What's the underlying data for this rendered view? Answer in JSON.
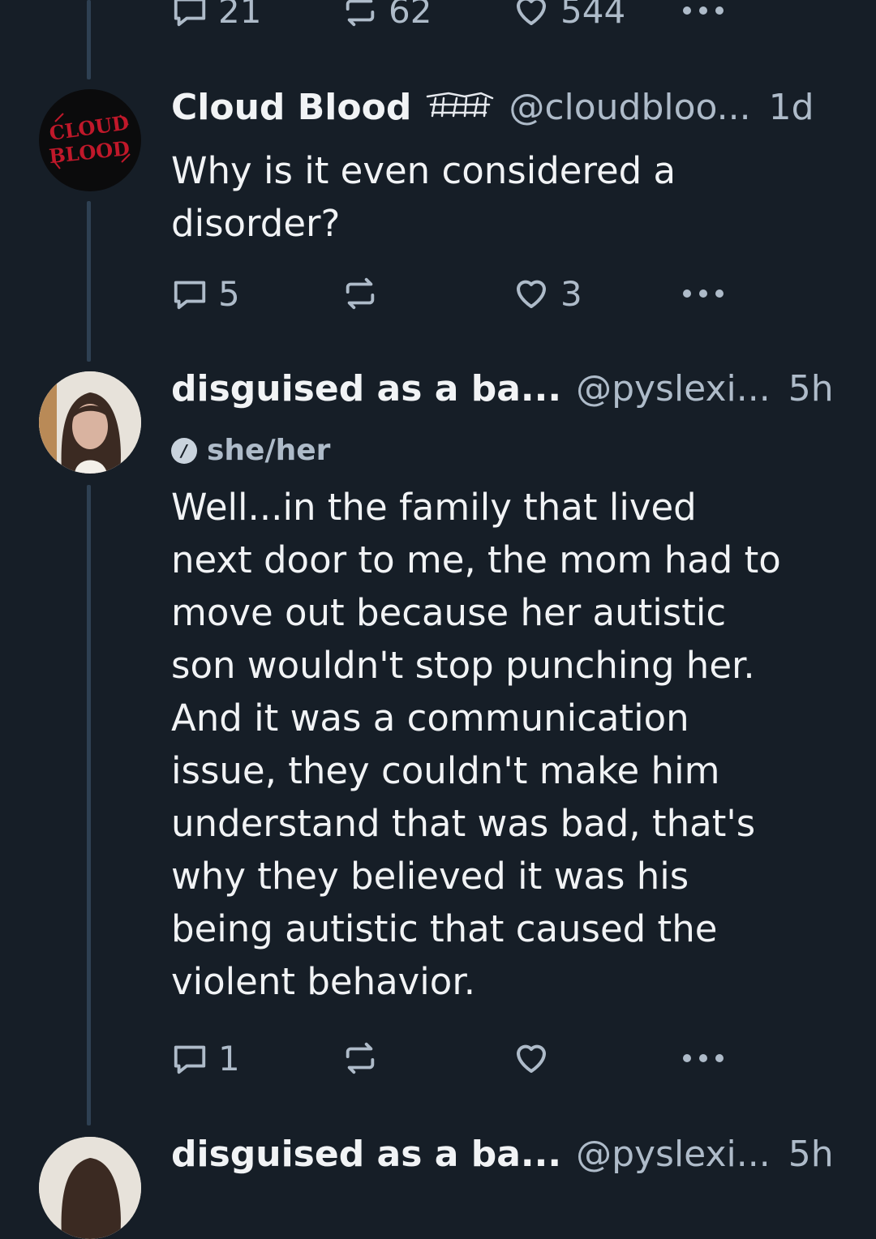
{
  "top_post_actions": {
    "replies": "21",
    "reposts": "62",
    "likes": "544"
  },
  "posts": [
    {
      "display_name": "Cloud Blood",
      "handle": "@cloudbloo...",
      "time": "1d",
      "avatar_text_line1": "CLOUD",
      "avatar_text_line2": "BLOOD",
      "text": "Why is it even considered a disorder?",
      "text_lines": [
        "Why is it even considered a",
        "disorder?"
      ],
      "replies": "5",
      "reposts": "",
      "likes": "3"
    },
    {
      "display_name": "disguised as a ba...",
      "handle": "@pyslexi...",
      "time": "5h",
      "pronouns": "she/her",
      "text_lines": [
        "Well...in the family that lived",
        "next door to me, the mom had to",
        "move out because her autistic",
        "son wouldn't stop punching her.",
        "And it was a communication",
        "issue, they couldn't make him",
        "understand that was bad, that's",
        "why they believed it was his",
        "being autistic that caused the",
        "violent behavior."
      ],
      "replies": "1",
      "reposts": "",
      "likes": ""
    }
  ],
  "next_post": {
    "display_name": "disguised as a ba...",
    "handle": "@pyslexi...",
    "time": "5h"
  },
  "colors": {
    "background": "#161e27",
    "thread_line": "#2e4052",
    "muted": "#aebbc9",
    "text": "#f1f3f5",
    "avatar_red": "#c0182a"
  }
}
